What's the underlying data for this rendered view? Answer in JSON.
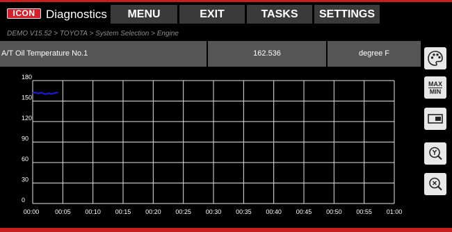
{
  "header": {
    "brand": "ICON",
    "title": "Diagnostics",
    "menu": [
      {
        "label": "MENU"
      },
      {
        "label": "EXIT"
      },
      {
        "label": "TASKS"
      },
      {
        "label": "SETTINGS"
      }
    ]
  },
  "breadcrumb": "DEMO V15.52 > TOYOTA > System Selection > Engine",
  "parameter": {
    "name": "A/T Oil Temperature No.1",
    "value": "162.536",
    "unit": "degree F"
  },
  "chart_data": {
    "type": "line",
    "title": "",
    "xlabel": "",
    "ylabel": "",
    "x_ticks": [
      "00:00",
      "00:05",
      "00:10",
      "00:15",
      "00:20",
      "00:25",
      "00:30",
      "00:35",
      "00:40",
      "00:45",
      "00:50",
      "00:55",
      "01:00"
    ],
    "y_ticks": [
      "0",
      "30",
      "60",
      "90",
      "120",
      "150",
      "180"
    ],
    "xlim": [
      0,
      60
    ],
    "ylim": [
      0,
      180
    ],
    "grid": true,
    "series": [
      {
        "color": "#1a1adf",
        "x": [
          0,
          0.3,
          0.6,
          0.9,
          1.2,
          1.5,
          1.8,
          2.1,
          2.4,
          2.7,
          3.0,
          3.3,
          3.6,
          3.9,
          4.2
        ],
        "y": [
          161.5,
          162.5,
          162.0,
          161.2,
          161.8,
          162.4,
          161.0,
          160.2,
          160.8,
          161.6,
          160.4,
          160.9,
          161.5,
          162.3,
          162.5
        ]
      }
    ]
  },
  "sidebar": [
    {
      "icon": "palette-icon"
    },
    {
      "icon": "max-min-icon",
      "top": "MAX",
      "bottom": "MIN"
    },
    {
      "icon": "toggle-view-icon"
    },
    {
      "icon": "y-zoom-icon"
    },
    {
      "icon": "x-zoom-icon"
    }
  ],
  "colors": {
    "accent": "#c81e1e",
    "header_button": "#3a3a3a",
    "param_bar": "#555555",
    "series": "#1a1adf"
  }
}
